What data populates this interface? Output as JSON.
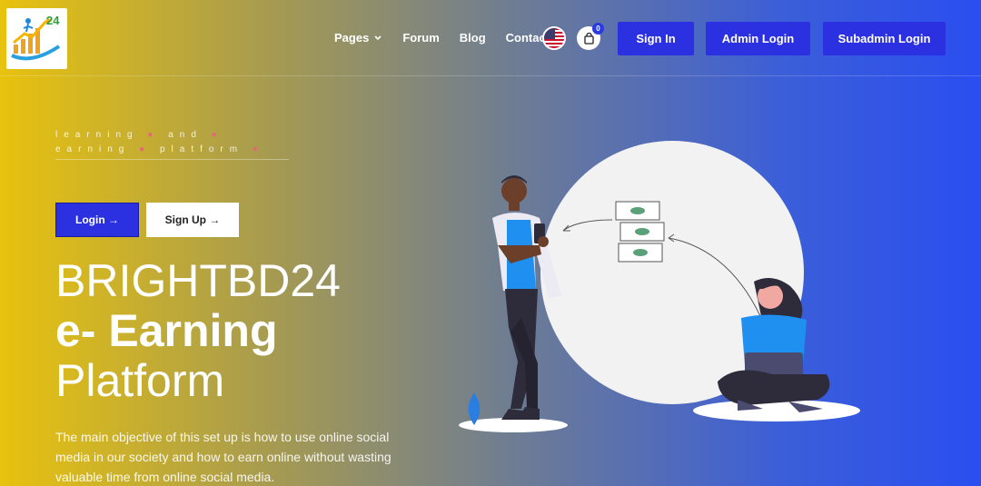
{
  "brand": {
    "logo_text": "24"
  },
  "nav": {
    "items": [
      {
        "label": "Pages",
        "has_dropdown": true
      },
      {
        "label": "Forum"
      },
      {
        "label": "Blog"
      },
      {
        "label": "Contact"
      }
    ],
    "cart_count": "0",
    "buttons": {
      "sign_in": "Sign In",
      "admin_login": "Admin Login",
      "subadmin_login": "Subadmin Login"
    }
  },
  "hero": {
    "tagline_line1": "learning",
    "tagline_line1b": "and",
    "tagline_line2": "earning",
    "tagline_line2b": "platform",
    "login_label": "Login →",
    "signup_label": "Sign Up →",
    "title_line1": "BRIGHTBD24",
    "title_line2": "e- Earning",
    "title_line3": "Platform",
    "description": "The main objective of this set up is how to use online social media in our society and how to earn online without wasting valuable time from online social media."
  },
  "colors": {
    "accent": "#2b30e0",
    "gradient_left": "#e8c20e",
    "gradient_right": "#2a4ef0"
  }
}
